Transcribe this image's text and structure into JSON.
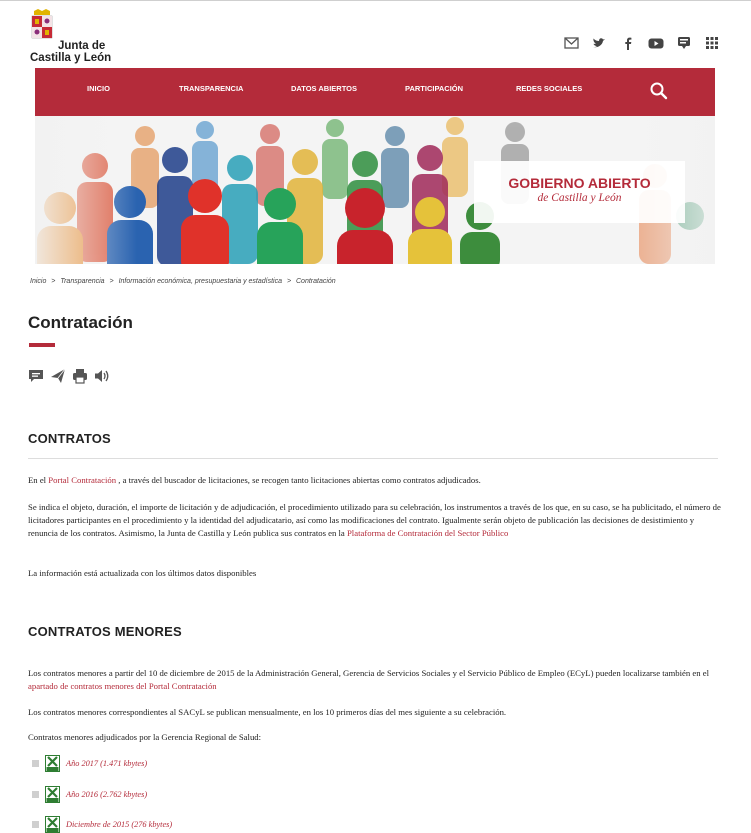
{
  "header": {
    "logo_line1": "Junta de",
    "logo_line2": "Castilla y León",
    "icons": [
      "mail-icon",
      "twitter-icon",
      "facebook-icon",
      "youtube-icon",
      "blog-icon",
      "apps-grid-icon"
    ]
  },
  "nav": {
    "items": [
      {
        "label": "INICIO"
      },
      {
        "label": "TRANSPARENCIA"
      },
      {
        "label": "DATOS ABIERTOS"
      },
      {
        "label": "PARTICIPACIÓN"
      },
      {
        "label": "REDES SOCIALES"
      }
    ],
    "search_icon": "search-icon"
  },
  "banner": {
    "title": "GOBIERNO ABIERTO",
    "subtitle": "de Castilla y León"
  },
  "breadcrumb": [
    "Inicio",
    ">",
    "Transparencia",
    ">",
    "Información económica, presupuestaria y estadística",
    ">",
    "Contratación"
  ],
  "page": {
    "title": "Contratación",
    "tools": [
      "comment-icon",
      "send-icon",
      "print-icon",
      "audio-icon"
    ]
  },
  "contratos": {
    "heading": "CONTRATOS",
    "p1_before": "En el ",
    "p1_link": "Portal Contratación",
    "p1_after": " , a través del buscador de licitaciones, se recogen tanto licitaciones abiertas como contratos adjudicados.",
    "p2_before": "Se indica el objeto, duración, el importe de licitación y de adjudicación, el procedimiento utilizado para su celebración, los instrumentos a través de los que, en su caso, se ha publicitado, el número de licitadores participantes en el procedimiento y la identidad del adjudicatario, así como las modificaciones del contrato. Igualmente serán objeto de publicación las decisiones de desistimiento y renuncia de los contratos. Asimismo, la Junta de Castilla y León publica sus contratos en la ",
    "p2_link": "Plataforma de Contratación del Sector Público",
    "p3": "La información está actualizada con los últimos datos disponibles"
  },
  "menores": {
    "heading": "CONTRATOS MENORES",
    "p1_before": "Los contratos menores a partir del 10 de diciembre de 2015 de la Administración General, Gerencia de Servicios Sociales y el Servicio Público de Empleo (ECyL) pueden localizarse también en el ",
    "p1_link": "apartado de contratos menores del Portal Contratación",
    "p2": "Los contratos menores correspondientes al SACyL se publican mensualmente, en los 10 primeros días del mes siguiente a su celebración.",
    "p3": "Contratos menores adjudicados por la Gerencia Regional de Salud:",
    "downloads": [
      {
        "label": "Año 2017 (1.471 kbytes)",
        "icon": "xls-file-icon"
      },
      {
        "label": "Año 2016 (2.762 kbytes)",
        "icon": "xls-file-icon"
      },
      {
        "label": "Diciembre de 2015 (276 kbytes)",
        "icon": "xls-file-icon"
      }
    ]
  },
  "colors": {
    "brand": "#b42b3a",
    "link": "#b42b3a"
  }
}
